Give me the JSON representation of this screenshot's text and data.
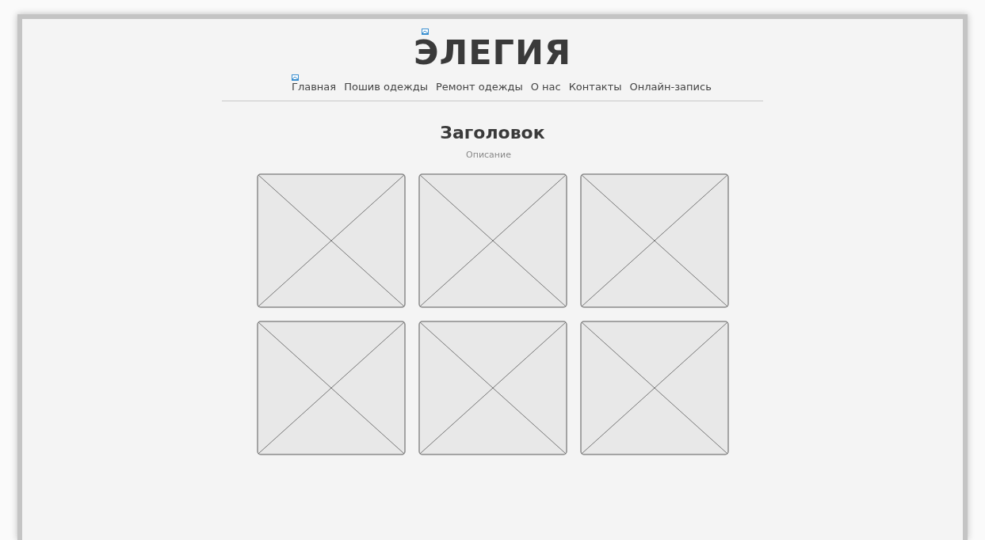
{
  "logo": {
    "text": "ЭЛЕГИЯ"
  },
  "nav": [
    {
      "label": "Главная"
    },
    {
      "label": "Пошив одежды"
    },
    {
      "label": "Ремонт одежды"
    },
    {
      "label": "О нас"
    },
    {
      "label": "Контакты"
    },
    {
      "label": "Онлайн-запись"
    }
  ],
  "heading": "Заголовок",
  "description": "Описание",
  "gallery": [
    {
      "kind": "placeholder"
    },
    {
      "kind": "placeholder"
    },
    {
      "kind": "placeholder"
    },
    {
      "kind": "placeholder"
    },
    {
      "kind": "placeholder"
    },
    {
      "kind": "placeholder"
    }
  ]
}
